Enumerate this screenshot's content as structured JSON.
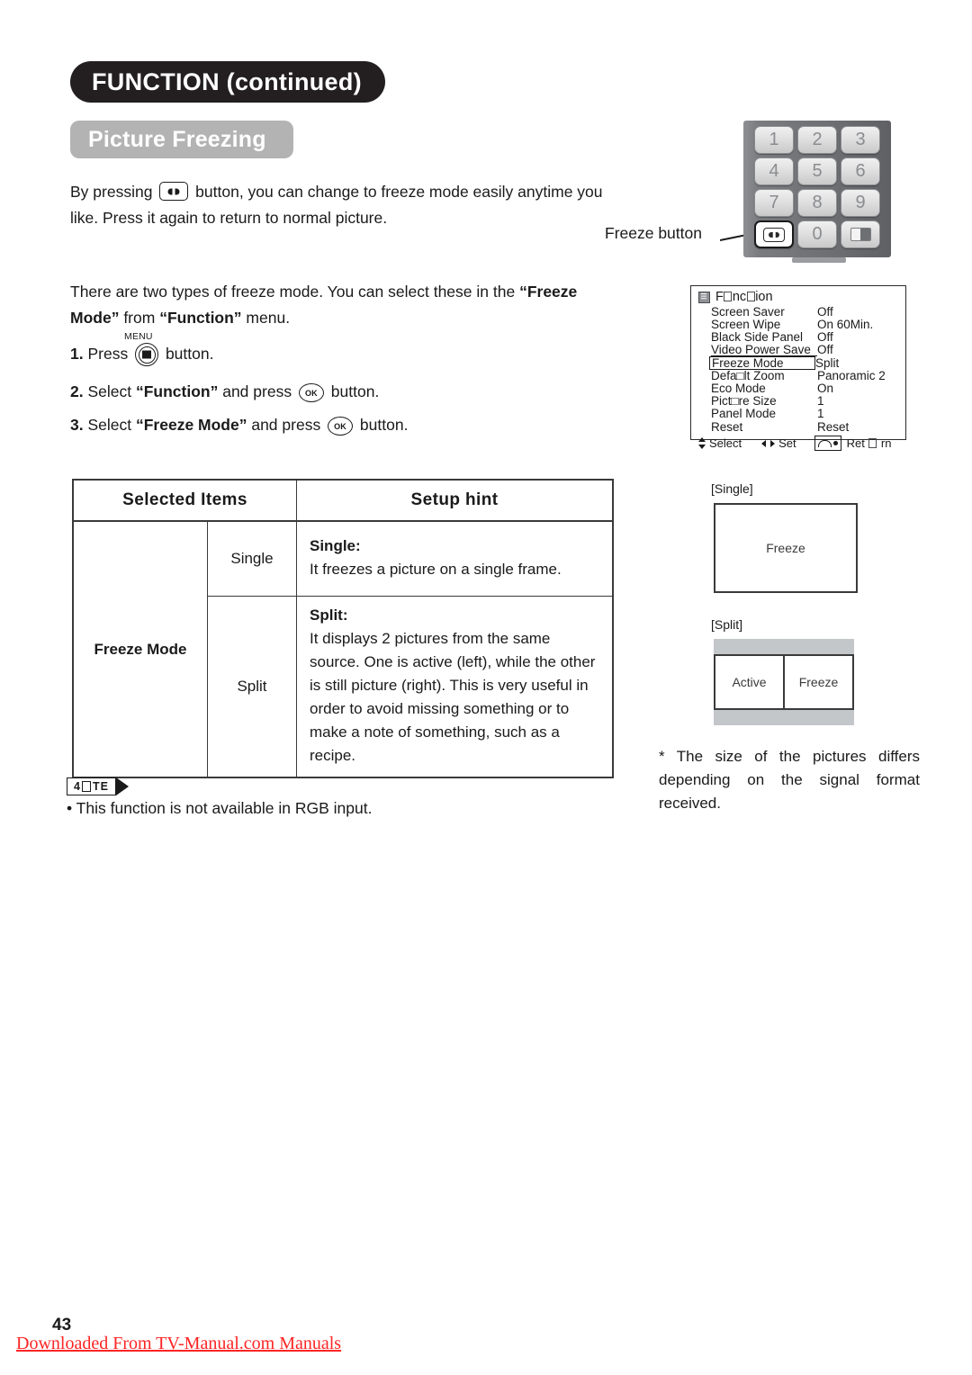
{
  "header": {
    "title": "FUNCTION (continued)",
    "subtitle": "Picture Freezing"
  },
  "intro": {
    "before_key": "By pressing ",
    "after_key": " button, you can change to freeze mode easily anytime you like. Press it again to return to normal picture."
  },
  "types": {
    "line1": "There are two types of freeze mode. You can select these in the ",
    "bold1": "“Freeze Mode”",
    "mid": " from ",
    "bold2": "“Function”",
    "tail": " menu."
  },
  "steps": {
    "menu_cap": "MENU",
    "ok_label": "OK",
    "step1": {
      "num": "1.",
      "before": " Press ",
      "after": " button."
    },
    "step2": {
      "num": "2.",
      "before": " Select ",
      "bold": "“Function”",
      "mid": " and press ",
      "after": " button."
    },
    "step3": {
      "num": "3.",
      "before": " Select ",
      "bold": "“Freeze Mode”",
      "mid": " and press ",
      "after": " button."
    }
  },
  "table": {
    "headers": [
      "Selected Items",
      "Setup hint"
    ],
    "item_label": "Freeze Mode",
    "rows": [
      {
        "mode": "Single",
        "hint_head": "Single:",
        "hint_body": "It freezes a picture on a single frame."
      },
      {
        "mode": "Split",
        "hint_head": "Split:",
        "hint_body": "It displays 2 pictures from the same source. One is active (left), while the other is still picture (right). This is very useful in order to avoid missing something or to make a note of something, such as a recipe."
      }
    ]
  },
  "note": {
    "badge_prefix": "4",
    "badge_suffix": "TE",
    "text": "• This function is not available in RGB input."
  },
  "remote": {
    "callout": "Freeze button",
    "keys": [
      "1",
      "2",
      "3",
      "4",
      "5",
      "6",
      "7",
      "8",
      "9"
    ],
    "zero": "0",
    "freeze_icon": "freeze-key-icon",
    "split_icon": "split-screen-key-icon"
  },
  "osd": {
    "title_a": "F",
    "title_b": "nc",
    "title_c": "ion",
    "rows": [
      {
        "key": "Screen Saver",
        "value": "Off",
        "style": "normal"
      },
      {
        "key": "Screen Wipe",
        "value": "On 60Min.",
        "style": "normal"
      },
      {
        "key": "Black Side Panel",
        "value": "Off",
        "style": "normal"
      },
      {
        "key": "Video Power Save",
        "value": "Off",
        "style": "underline"
      },
      {
        "key": "Freeze Mode",
        "value": "Split",
        "style": "boxed"
      },
      {
        "key": "Defa□lt Zoom",
        "value": "Panoramic 2",
        "style": "normal"
      },
      {
        "key": "Eco Mode",
        "value": "On",
        "style": "normal"
      },
      {
        "key": "Pict□re Size",
        "value": "1",
        "style": "normal"
      },
      {
        "key": "Panel Mode",
        "value": "1",
        "style": "normal"
      },
      {
        "key": "Reset",
        "value": "Reset",
        "style": "normal"
      }
    ],
    "footer": {
      "select": "Select",
      "set": "Set",
      "return_a": "Ret",
      "return_b": "rn"
    }
  },
  "diagrams": {
    "single_label": "[Single]",
    "single_text": "Freeze",
    "split_label": "[Split]",
    "split_left": "Active",
    "split_right": "Freeze"
  },
  "size_note": "* The size of the pictures differs depending on the signal format received.",
  "footer": {
    "page_number": "43",
    "download_link": "Downloaded From TV-Manual.com Manuals"
  },
  "colors": {
    "title_bg": "#231f20",
    "subtitle_bg": "#b3b3b3",
    "link_red": "#ff2424",
    "remote_body": "#6e7074",
    "split_bar": "#c3c7ca"
  }
}
